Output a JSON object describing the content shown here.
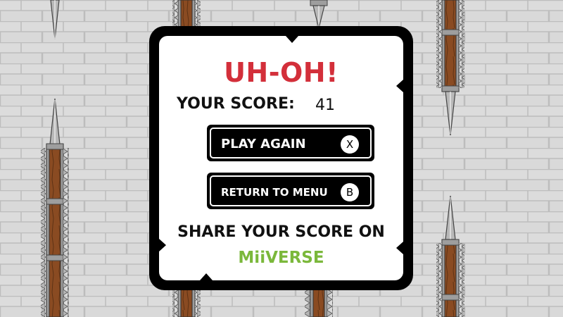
{
  "game_over": {
    "title": "UH-OH!",
    "score_label": "YOUR SCORE:",
    "score_value": "41",
    "play_again_label": "PLAY AGAIN",
    "play_again_key": "X",
    "return_menu_label": "RETURN TO MENU",
    "return_menu_key": "B",
    "share_label": "SHARE YOUR SCORE ON",
    "share_service": "MiiVERSE"
  },
  "colors": {
    "title_red": "#d32f3a",
    "miiverse_green": "#7bb83b",
    "wall": "#d9d9d9",
    "mortar": "#b8b8b8",
    "wood": "#8a4b22",
    "metal": "#a9a9a9"
  }
}
